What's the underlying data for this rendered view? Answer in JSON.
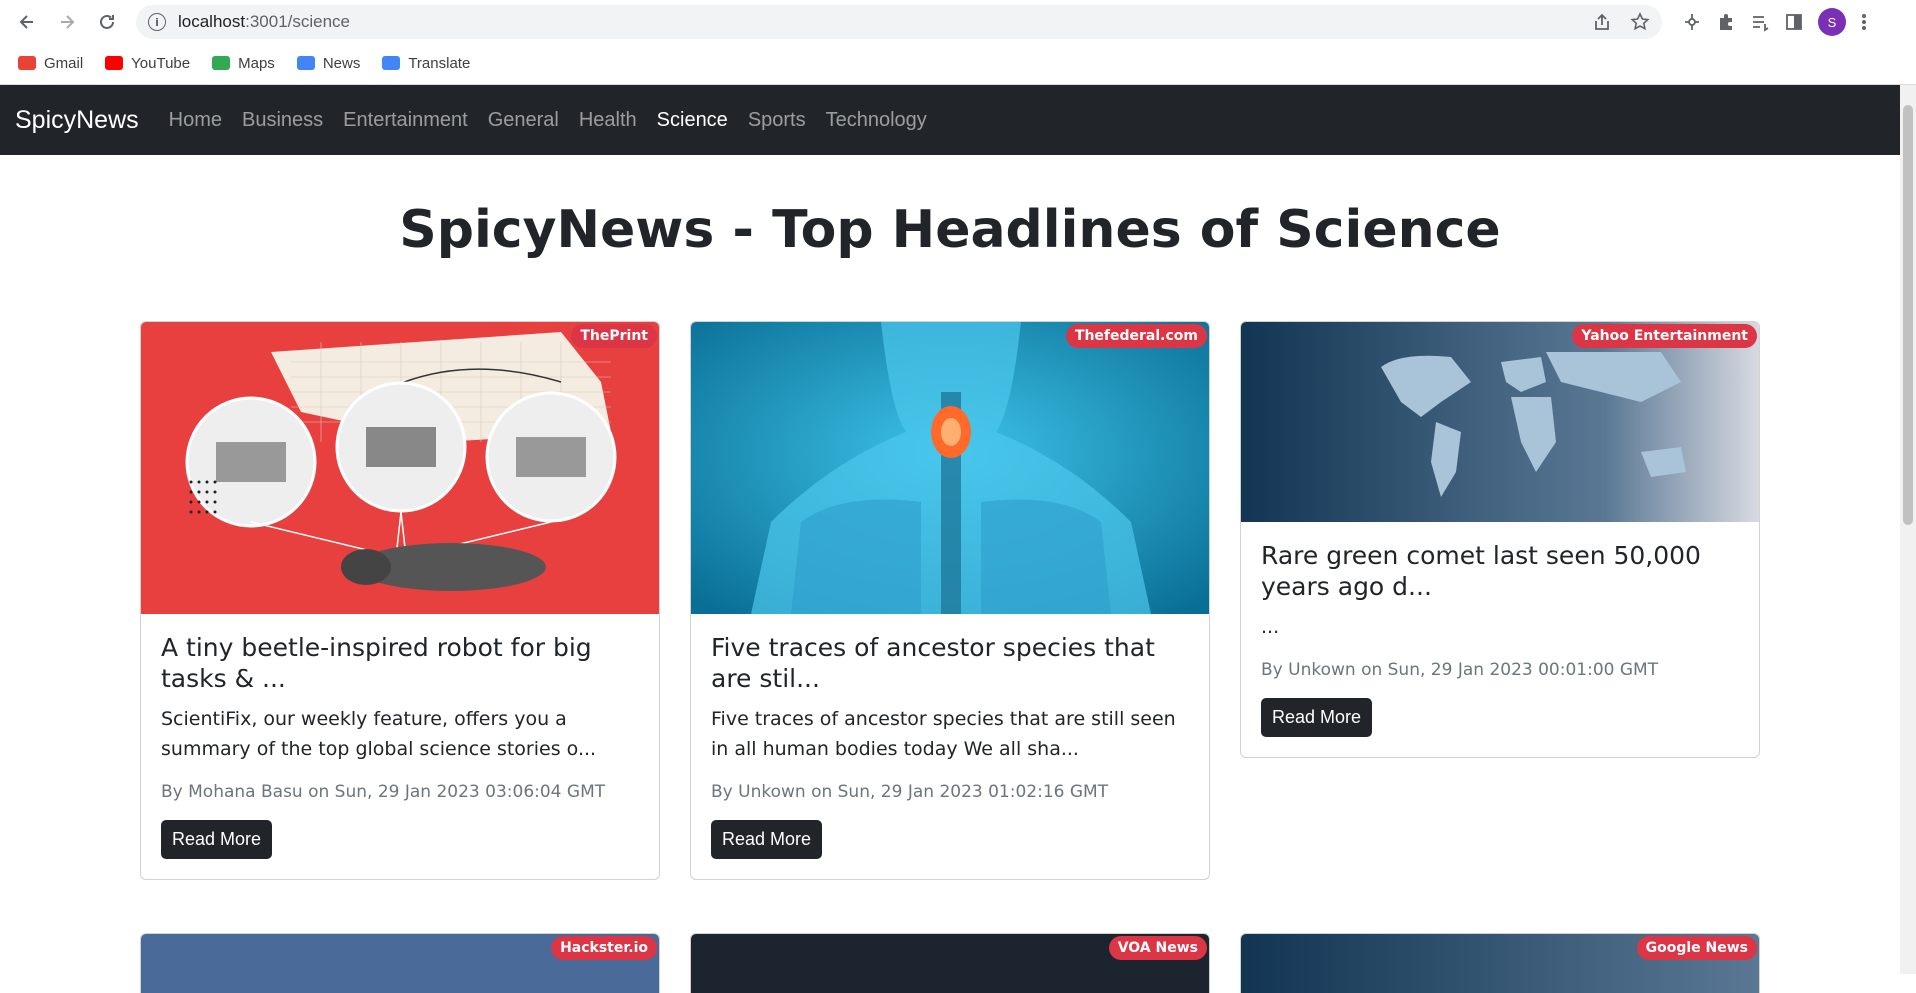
{
  "browser": {
    "url_host": "localhost",
    "url_path": ":3001/science",
    "profile_initial": "S",
    "bookmarks": [
      {
        "label": "Gmail",
        "color": "#ea4335"
      },
      {
        "label": "YouTube",
        "color": "#ff0000"
      },
      {
        "label": "Maps",
        "color": "#34a853"
      },
      {
        "label": "News",
        "color": "#4285f4"
      },
      {
        "label": "Translate",
        "color": "#4285f4"
      }
    ]
  },
  "navbar": {
    "brand": "SpicyNews",
    "links": [
      "Home",
      "Business",
      "Entertainment",
      "General",
      "Health",
      "Science",
      "Sports",
      "Technology"
    ],
    "active": "Science"
  },
  "page": {
    "title": "SpicyNews - Top Headlines of Science"
  },
  "cards": [
    {
      "source": "ThePrint",
      "title": "A tiny beetle-inspired robot for big tasks & ...",
      "description": "ScientiFix, our weekly feature, offers you a summary of the top global science stories o...",
      "meta": "By Mohana Basu on Sun, 29 Jan 2023 03:06:04 GMT",
      "button": "Read More",
      "image": "beetle-robot-image"
    },
    {
      "source": "Thefederal.com",
      "title": "Five traces of ancestor species that are stil...",
      "description": "Five traces of ancestor species that are still seen in all human bodies today We all sha...",
      "meta": "By Unkown on Sun, 29 Jan 2023 01:02:16 GMT",
      "button": "Read More",
      "image": "human-anatomy-image"
    },
    {
      "source": "Yahoo Entertainment",
      "title": "Rare green comet last seen 50,000 years ago d...",
      "description": "...",
      "meta": "By Unkown on Sun, 29 Jan 2023 00:01:00 GMT",
      "button": "Read More",
      "image": "world-map-image"
    },
    {
      "source": "Hackster.io"
    },
    {
      "source": "VOA News"
    },
    {
      "source": "Google News"
    }
  ]
}
